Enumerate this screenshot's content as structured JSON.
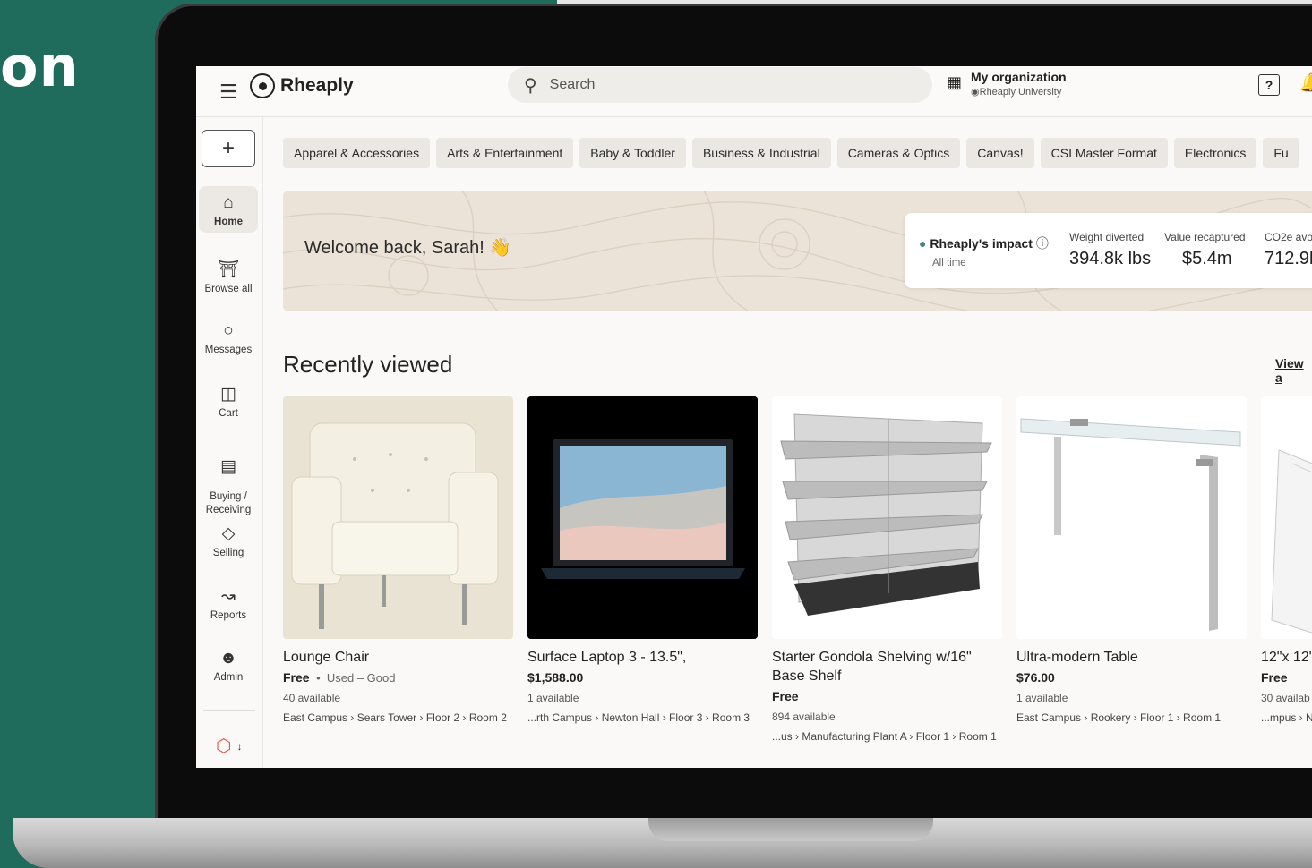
{
  "hero": {
    "text": "on"
  },
  "header": {
    "logo_text": "Rheaply",
    "search_placeholder": "Search",
    "org_name": "My organization",
    "org_sub": "Rheaply University",
    "help_label": "?"
  },
  "sidebar": {
    "add_label": "+",
    "items": [
      {
        "label": "Home",
        "icon": "home-icon"
      },
      {
        "label": "Browse all",
        "icon": "storefront-icon"
      },
      {
        "label": "Messages",
        "icon": "chat-icon"
      },
      {
        "label": "Cart",
        "icon": "cart-icon"
      },
      {
        "label": "Buying /\nReceiving",
        "icon": "basket-icon"
      },
      {
        "label": "Selling",
        "icon": "tag-icon"
      },
      {
        "label": "Reports",
        "icon": "chart-icon"
      },
      {
        "label": "Admin",
        "icon": "admin-icon"
      }
    ]
  },
  "categories": [
    "Apparel & Accessories",
    "Arts & Entertainment",
    "Baby & Toddler",
    "Business & Industrial",
    "Cameras & Optics",
    "Canvas!",
    "CSI Master Format",
    "Electronics",
    "Fu"
  ],
  "banner": {
    "welcome": "Welcome back, Sarah! 👋",
    "impact_title": "Rheaply's impact",
    "impact_sub": "All time",
    "metrics": [
      {
        "label": "Weight diverted",
        "value": "394.8k lbs"
      },
      {
        "label": "Value recaptured",
        "value": "$5.4m"
      },
      {
        "label": "CO2e avo",
        "value": "712.9k"
      }
    ]
  },
  "recent": {
    "title": "Recently viewed",
    "view_all": "View a",
    "items": [
      {
        "name": "Lounge Chair",
        "price": "Free",
        "condition": "Used – Good",
        "available": "40 available",
        "location": "East Campus › Sears Tower › Floor 2 › Room 2"
      },
      {
        "name": "Surface Laptop 3 - 13.5\",",
        "price": "$1,588.00",
        "condition": "",
        "available": "1 available",
        "location": "...rth Campus › Newton Hall › Floor 3 › Room 3"
      },
      {
        "name": "Starter Gondola Shelving w/16\" Base Shelf",
        "price": "Free",
        "condition": "",
        "available": "894 available",
        "location": "...us › Manufacturing Plant A › Floor 1 › Room 1"
      },
      {
        "name": "Ultra-modern Table",
        "price": "$76.00",
        "condition": "",
        "available": "1 available",
        "location": "East Campus › Rookery › Floor 1 › Room 1"
      },
      {
        "name": "12\"x 12\" (",
        "price": "Free",
        "condition": "",
        "available": "30 availab",
        "location": "...mpus › N"
      }
    ]
  },
  "colors": {
    "background": "#1f6b5c",
    "accent": "#e4574a",
    "banner": "#ebe3d7"
  }
}
